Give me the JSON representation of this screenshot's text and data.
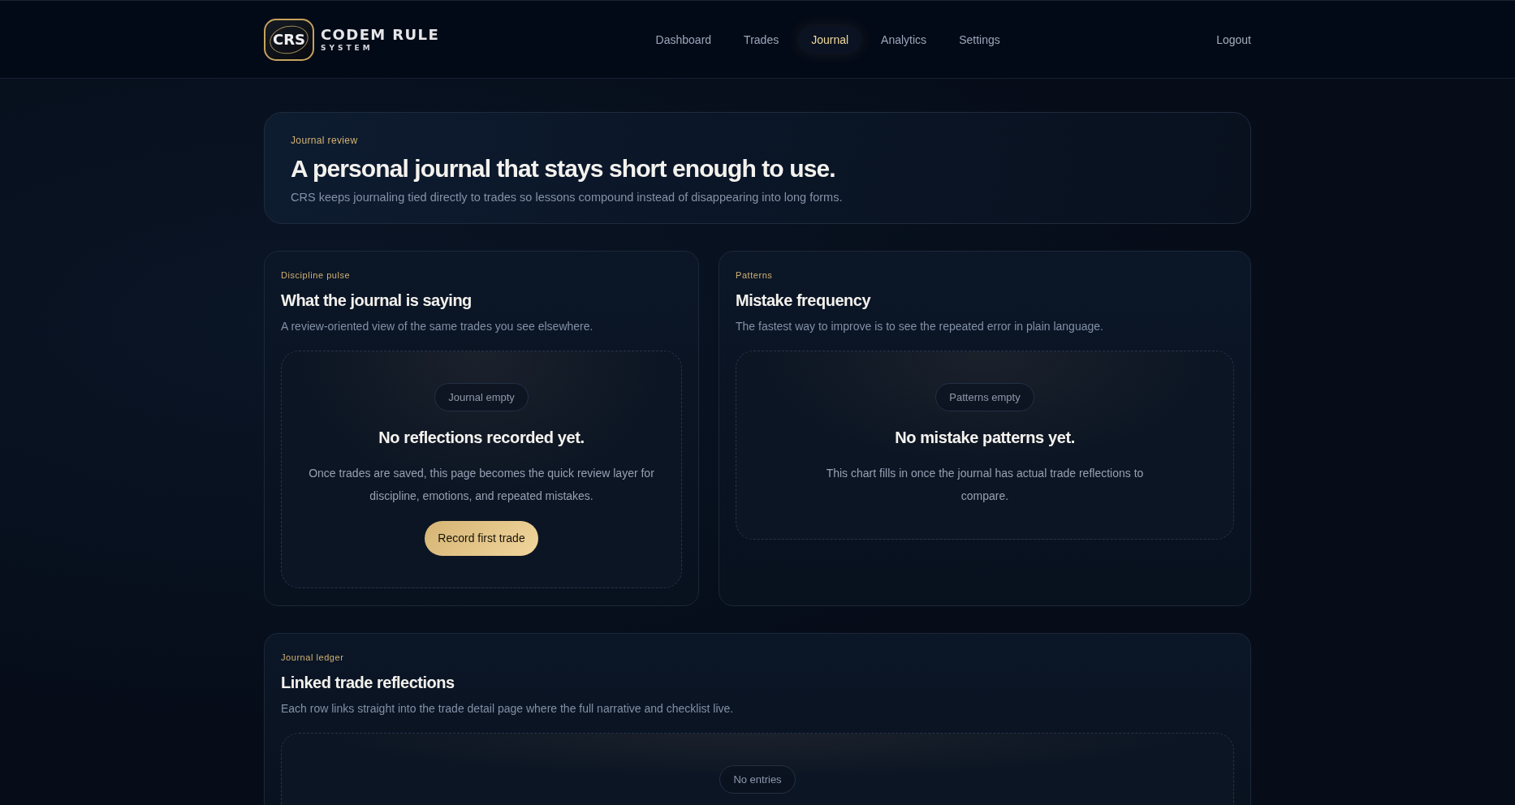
{
  "header": {
    "logo": {
      "mark": "CRS",
      "name": "CODEM RULE",
      "tagline": "SYSTEM"
    },
    "nav": [
      {
        "label": "Dashboard",
        "selected": false
      },
      {
        "label": "Trades",
        "selected": false
      },
      {
        "label": "Journal",
        "selected": true
      },
      {
        "label": "Analytics",
        "selected": false
      },
      {
        "label": "Settings",
        "selected": false
      }
    ],
    "logout": "Logout"
  },
  "hero": {
    "eyebrow": "Journal review",
    "title": "A personal journal that stays short enough to use.",
    "subtitle": "CRS keeps journaling tied directly to trades so lessons compound instead of disappearing into long forms."
  },
  "panels": [
    {
      "eyebrow": "Discipline pulse",
      "title": "What the journal is saying",
      "subtitle": "A review-oriented view of the same trades you see elsewhere.",
      "empty_state": {
        "badge": "Journal empty",
        "title": "No reflections recorded yet.",
        "text": "Once trades are saved, this page becomes the quick review layer for discipline, emotions, and repeated mistakes.",
        "action": "Record first trade"
      }
    },
    {
      "eyebrow": "Patterns",
      "title": "Mistake frequency",
      "subtitle": "The fastest way to improve is to see the repeated error in plain language.",
      "empty_state": {
        "badge": "Patterns empty",
        "title": "No mistake patterns yet.",
        "text": "This chart fills in once the journal has actual trade reflections to compare."
      }
    }
  ],
  "ledger": {
    "eyebrow": "Journal ledger",
    "title": "Linked trade reflections",
    "subtitle": "Each row links straight into the trade detail page where the full narrative and checklist live.",
    "empty_state": {
      "badge": "No entries"
    }
  }
}
